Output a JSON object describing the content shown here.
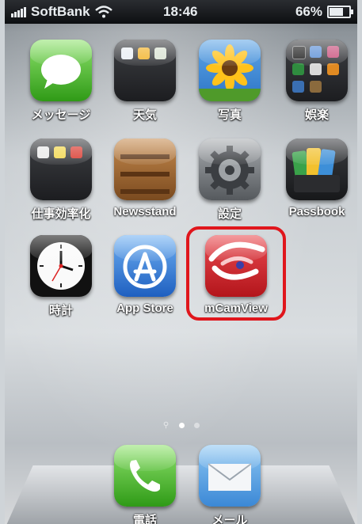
{
  "status_bar": {
    "carrier": "SoftBank",
    "time": "18:46",
    "battery_percent": "66%",
    "battery_level": 0.66
  },
  "apps": [
    {
      "label": "メッセージ",
      "icon": "messages-icon"
    },
    {
      "label": "天気",
      "icon": "weather-folder-icon"
    },
    {
      "label": "写真",
      "icon": "photos-icon"
    },
    {
      "label": "娯楽",
      "icon": "entertainment-folder-icon"
    },
    {
      "label": "仕事効率化",
      "icon": "productivity-folder-icon"
    },
    {
      "label": "Newsstand",
      "icon": "newsstand-icon"
    },
    {
      "label": "設定",
      "icon": "settings-icon"
    },
    {
      "label": "Passbook",
      "icon": "passbook-icon"
    },
    {
      "label": "時計",
      "icon": "clock-icon"
    },
    {
      "label": "App Store",
      "icon": "app-store-icon"
    },
    {
      "label": "mCamView",
      "icon": "mcamview-icon"
    }
  ],
  "dock": [
    {
      "label": "電話",
      "icon": "phone-icon"
    },
    {
      "label": "メール",
      "icon": "mail-icon"
    }
  ],
  "page_indicator": {
    "pages": 2,
    "current": 1
  },
  "highlight_color": "#e0161c"
}
